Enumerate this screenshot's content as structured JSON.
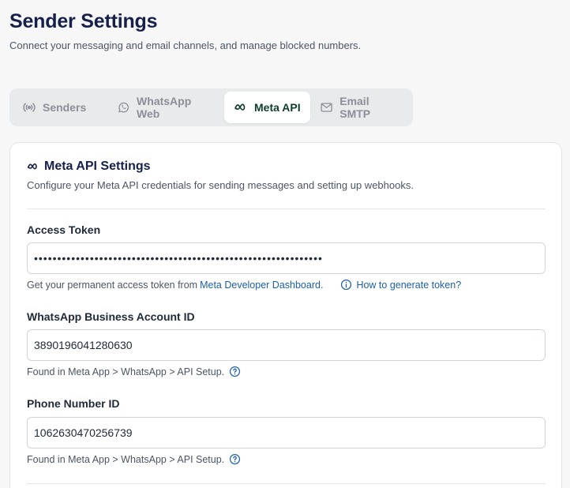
{
  "header": {
    "title": "Sender Settings",
    "subtitle": "Connect your messaging and email channels, and manage blocked numbers."
  },
  "tabs": [
    {
      "label": "Senders",
      "icon": "broadcast-icon",
      "active": false
    },
    {
      "label": "WhatsApp Web",
      "icon": "whatsapp-icon",
      "active": false
    },
    {
      "label": "Meta API",
      "icon": "meta-icon",
      "active": true
    },
    {
      "label": "Email SMTP",
      "icon": "mail-icon",
      "active": false
    }
  ],
  "card": {
    "title": "Meta API Settings",
    "description": "Configure your Meta API credentials for sending messages and setting up webhooks.",
    "access_token": {
      "label": "Access Token",
      "value": "••••••••••••••••••••••••••••••••••••••••••••••••••••••••••••••",
      "help_prefix": "Get your permanent access token from",
      "help_link": "Meta Developer Dashboard",
      "help_suffix": ".",
      "how_to_link": "How to generate token?"
    },
    "business_account_id": {
      "label": "WhatsApp Business Account ID",
      "value": "3890196041280630",
      "help": "Found in Meta App > WhatsApp > API Setup."
    },
    "phone_number_id": {
      "label": "Phone Number ID",
      "value": "1062630470256739",
      "help": "Found in Meta App > WhatsApp > API Setup."
    }
  },
  "colors": {
    "heading": "#16204a",
    "active_tab_text": "#0f3d2e",
    "link": "#1d5fa8",
    "page_background": "#f7f7f8"
  }
}
